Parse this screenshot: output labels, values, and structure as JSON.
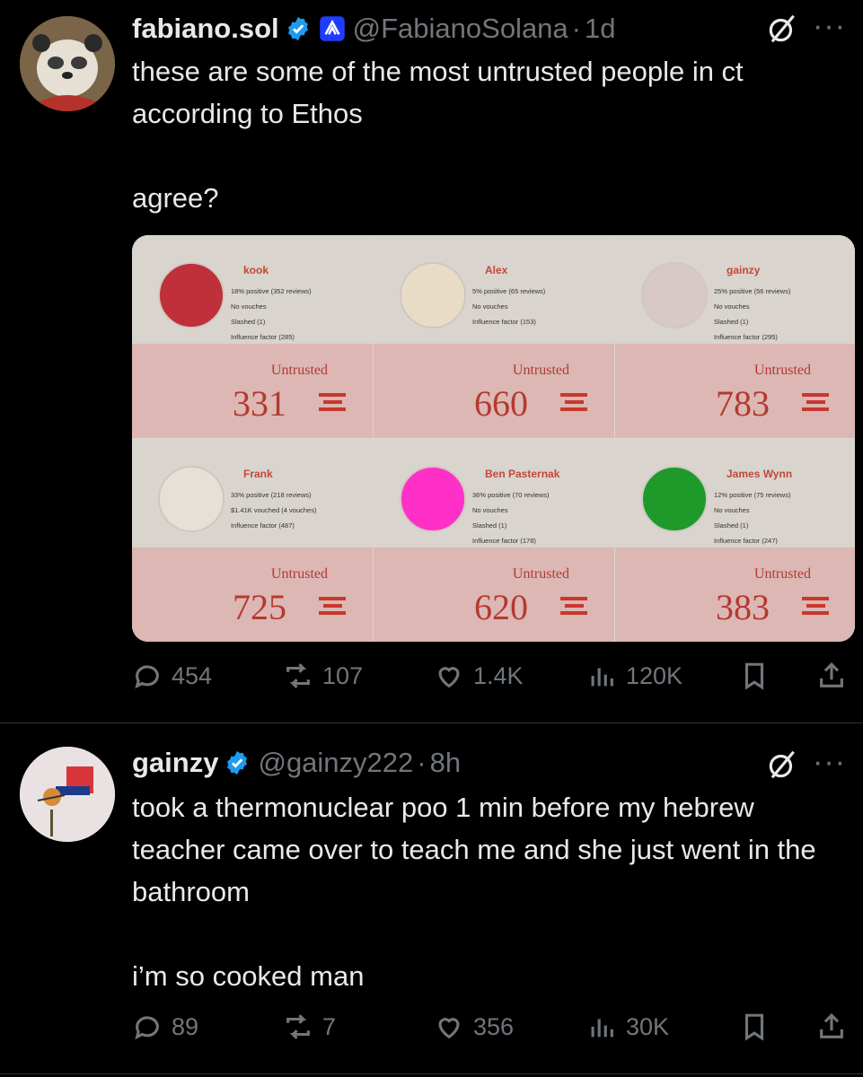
{
  "tweets": [
    {
      "name": "fabiano.sol",
      "handle": "@FabianoSolana",
      "time": "1d",
      "text": "these are some of the most untrusted people in ct according to Ethos\n\nagree?",
      "stats": {
        "replies": "454",
        "reposts": "107",
        "likes": "1.4K",
        "views": "120K"
      }
    },
    {
      "name": "gainzy",
      "handle": "@gainzy222",
      "time": "8h",
      "text": "took a thermonuclear poo 1 min before my hebrew teacher came over to teach me and she just went in the bathroom\n\ni’m so cooked man",
      "stats": {
        "replies": "89",
        "reposts": "7",
        "likes": "356",
        "views": "30K"
      }
    }
  ],
  "more_glyph": "···",
  "dot": "·",
  "cards": [
    {
      "name": "kook",
      "lines": [
        "18% positive (352 reviews)",
        "No vouches",
        "Slashed (1)",
        "Influence factor (285)"
      ],
      "label": "Untrusted",
      "score": "331",
      "avatar_color": "#c0303a"
    },
    {
      "name": "Alex",
      "lines": [
        "5% positive (65 reviews)",
        "No vouches",
        "Influence factor (153)"
      ],
      "label": "Untrusted",
      "score": "660",
      "avatar_color": "#e8dcc6"
    },
    {
      "name": "gainzy",
      "lines": [
        "25% positive (56 reviews)",
        "No vouches",
        "Slashed (1)",
        "Influence factor (295)"
      ],
      "label": "Untrusted",
      "score": "783",
      "avatar_color": "#d8c8c8"
    },
    {
      "name": "Frank",
      "lines": [
        "33% positive (218 reviews)",
        "$1.41K vouched (4 vouches)",
        "Influence factor (487)"
      ],
      "label": "Untrusted",
      "score": "725",
      "avatar_color": "#e6e0d6"
    },
    {
      "name": "Ben Pasternak",
      "lines": [
        "36% positive (70 reviews)",
        "No vouches",
        "Slashed (1)",
        "Influence factor (178)"
      ],
      "label": "Untrusted",
      "score": "620",
      "avatar_color": "#ff30c8"
    },
    {
      "name": "James Wynn",
      "lines": [
        "12% positive (75 reviews)",
        "No vouches",
        "Slashed (1)",
        "Influence factor (247)"
      ],
      "label": "Untrusted",
      "score": "383",
      "avatar_color": "#1e9a2a"
    }
  ],
  "colors": {
    "background": "#000000",
    "text": "#e7e9ea",
    "muted": "#71767b",
    "verified": "#1d9bf0",
    "accent_red": "#b33a30"
  }
}
